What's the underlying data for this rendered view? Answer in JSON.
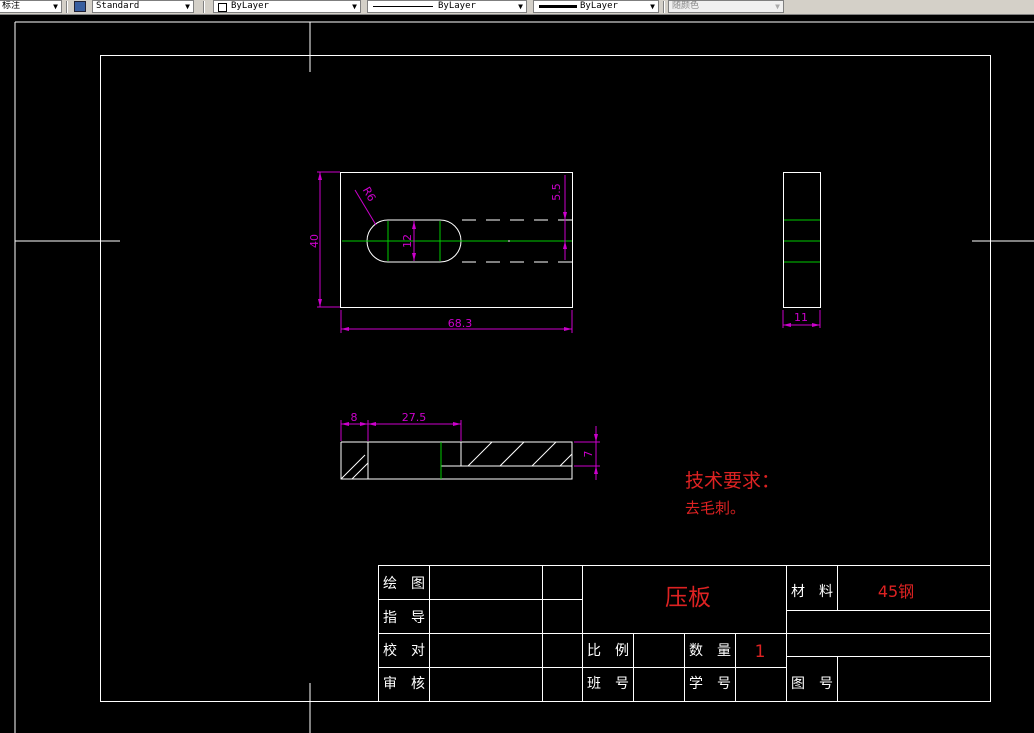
{
  "toolbar": {
    "dim_style": "标注",
    "text_style": "Standard",
    "layer": "ByLayer",
    "linetype": "ByLayer",
    "lineweight": "ByLayer",
    "color": "随颜色"
  },
  "drawing": {
    "dimensions": {
      "width": "68.3",
      "height": "40",
      "slot_width": "12",
      "radius": "R6",
      "offset": "5.5",
      "side_thickness": "11",
      "bottom_left": "8",
      "bottom_mid": "27.5",
      "bottom_height": "7"
    },
    "notes": {
      "title": "技术要求：",
      "body": "去毛刺。"
    },
    "title_block": {
      "drawn": "绘　图",
      "guide": "指　导",
      "check": "校　对",
      "review": "审　核",
      "part_name": "压板",
      "scale": "比　例",
      "quantity": "数　量",
      "quantity_value": "1",
      "class": "班　号",
      "student_no": "学　号",
      "material": "材　料",
      "material_value": "45钢",
      "drawing_no": "图　号"
    }
  },
  "colors": {
    "background": "#000000",
    "outline": "#ffffff",
    "centerline": "#00cc00",
    "dimension": "#cc00cc",
    "annotation": "#dd2222"
  }
}
